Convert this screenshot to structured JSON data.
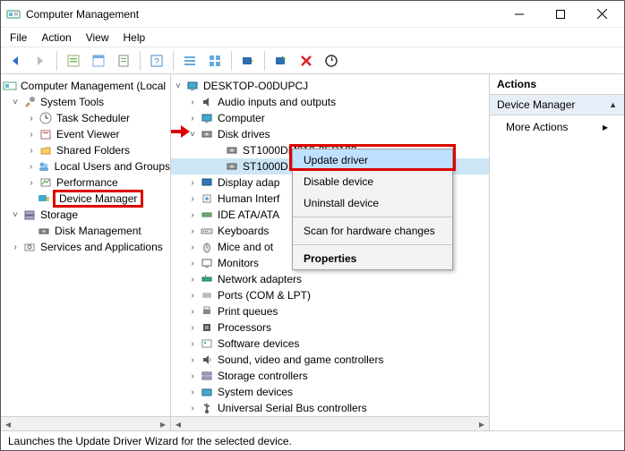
{
  "window": {
    "title": "Computer Management"
  },
  "menu": {
    "file": "File",
    "action": "Action",
    "view": "View",
    "help": "Help"
  },
  "left_tree": {
    "root": "Computer Management (Local",
    "system_tools": "System Tools",
    "task_scheduler": "Task Scheduler",
    "event_viewer": "Event Viewer",
    "shared_folders": "Shared Folders",
    "local_users": "Local Users and Groups",
    "performance": "Performance",
    "device_manager": "Device Manager",
    "storage": "Storage",
    "disk_management": "Disk Management",
    "services_apps": "Services and Applications"
  },
  "mid_tree": {
    "root": "DESKTOP-O0DUPCJ",
    "items": [
      {
        "label": "Audio inputs and outputs",
        "icon": "speaker"
      },
      {
        "label": "Computer",
        "icon": "computer"
      },
      {
        "label": "Disk drives",
        "icon": "disk",
        "expanded": true,
        "children": [
          {
            "label": "ST1000DM010-2EP102"
          },
          {
            "label": "ST1000D",
            "selected": true
          }
        ]
      },
      {
        "label": "Display adap",
        "icon": "display"
      },
      {
        "label": "Human Interf",
        "icon": "hid"
      },
      {
        "label": "IDE ATA/ATA",
        "icon": "ide"
      },
      {
        "label": "Keyboards",
        "icon": "keyboard"
      },
      {
        "label": "Mice and ot",
        "icon": "mouse"
      },
      {
        "label": "Monitors",
        "icon": "monitor"
      },
      {
        "label": "Network adapters",
        "icon": "network"
      },
      {
        "label": "Ports (COM & LPT)",
        "icon": "port"
      },
      {
        "label": "Print queues",
        "icon": "printer"
      },
      {
        "label": "Processors",
        "icon": "cpu"
      },
      {
        "label": "Software devices",
        "icon": "software"
      },
      {
        "label": "Sound, video and game controllers",
        "icon": "sound"
      },
      {
        "label": "Storage controllers",
        "icon": "storage"
      },
      {
        "label": "System devices",
        "icon": "system"
      },
      {
        "label": "Universal Serial Bus controllers",
        "icon": "usb"
      }
    ]
  },
  "context_menu": {
    "update_driver": "Update driver",
    "disable": "Disable device",
    "uninstall": "Uninstall device",
    "scan": "Scan for hardware changes",
    "properties": "Properties"
  },
  "actions": {
    "heading": "Actions",
    "section": "Device Manager",
    "more": "More Actions"
  },
  "status": "Launches the Update Driver Wizard for the selected device."
}
